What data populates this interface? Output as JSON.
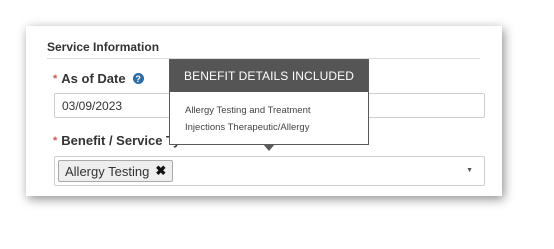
{
  "section": {
    "title": "Service Information"
  },
  "as_of": {
    "required_marker": "*",
    "label": "As of Date",
    "help_icon": "question-circle-icon",
    "value": "03/09/2023"
  },
  "benefit": {
    "required_marker": "*",
    "label": "Benefit / Service Ty",
    "selected": [
      "Allergy Testing"
    ],
    "remove_icon": "close-icon",
    "dropdown_icon": "caret-down-icon"
  },
  "tooltip": {
    "title": "BENEFIT DETAILS INCLUDED",
    "items": [
      "Allergy Testing and Treatment",
      "Injections Therapeutic/Allergy"
    ]
  },
  "colors": {
    "required": "#d9534f",
    "help_icon": "#2e6da4",
    "tooltip_header": "#555555"
  }
}
